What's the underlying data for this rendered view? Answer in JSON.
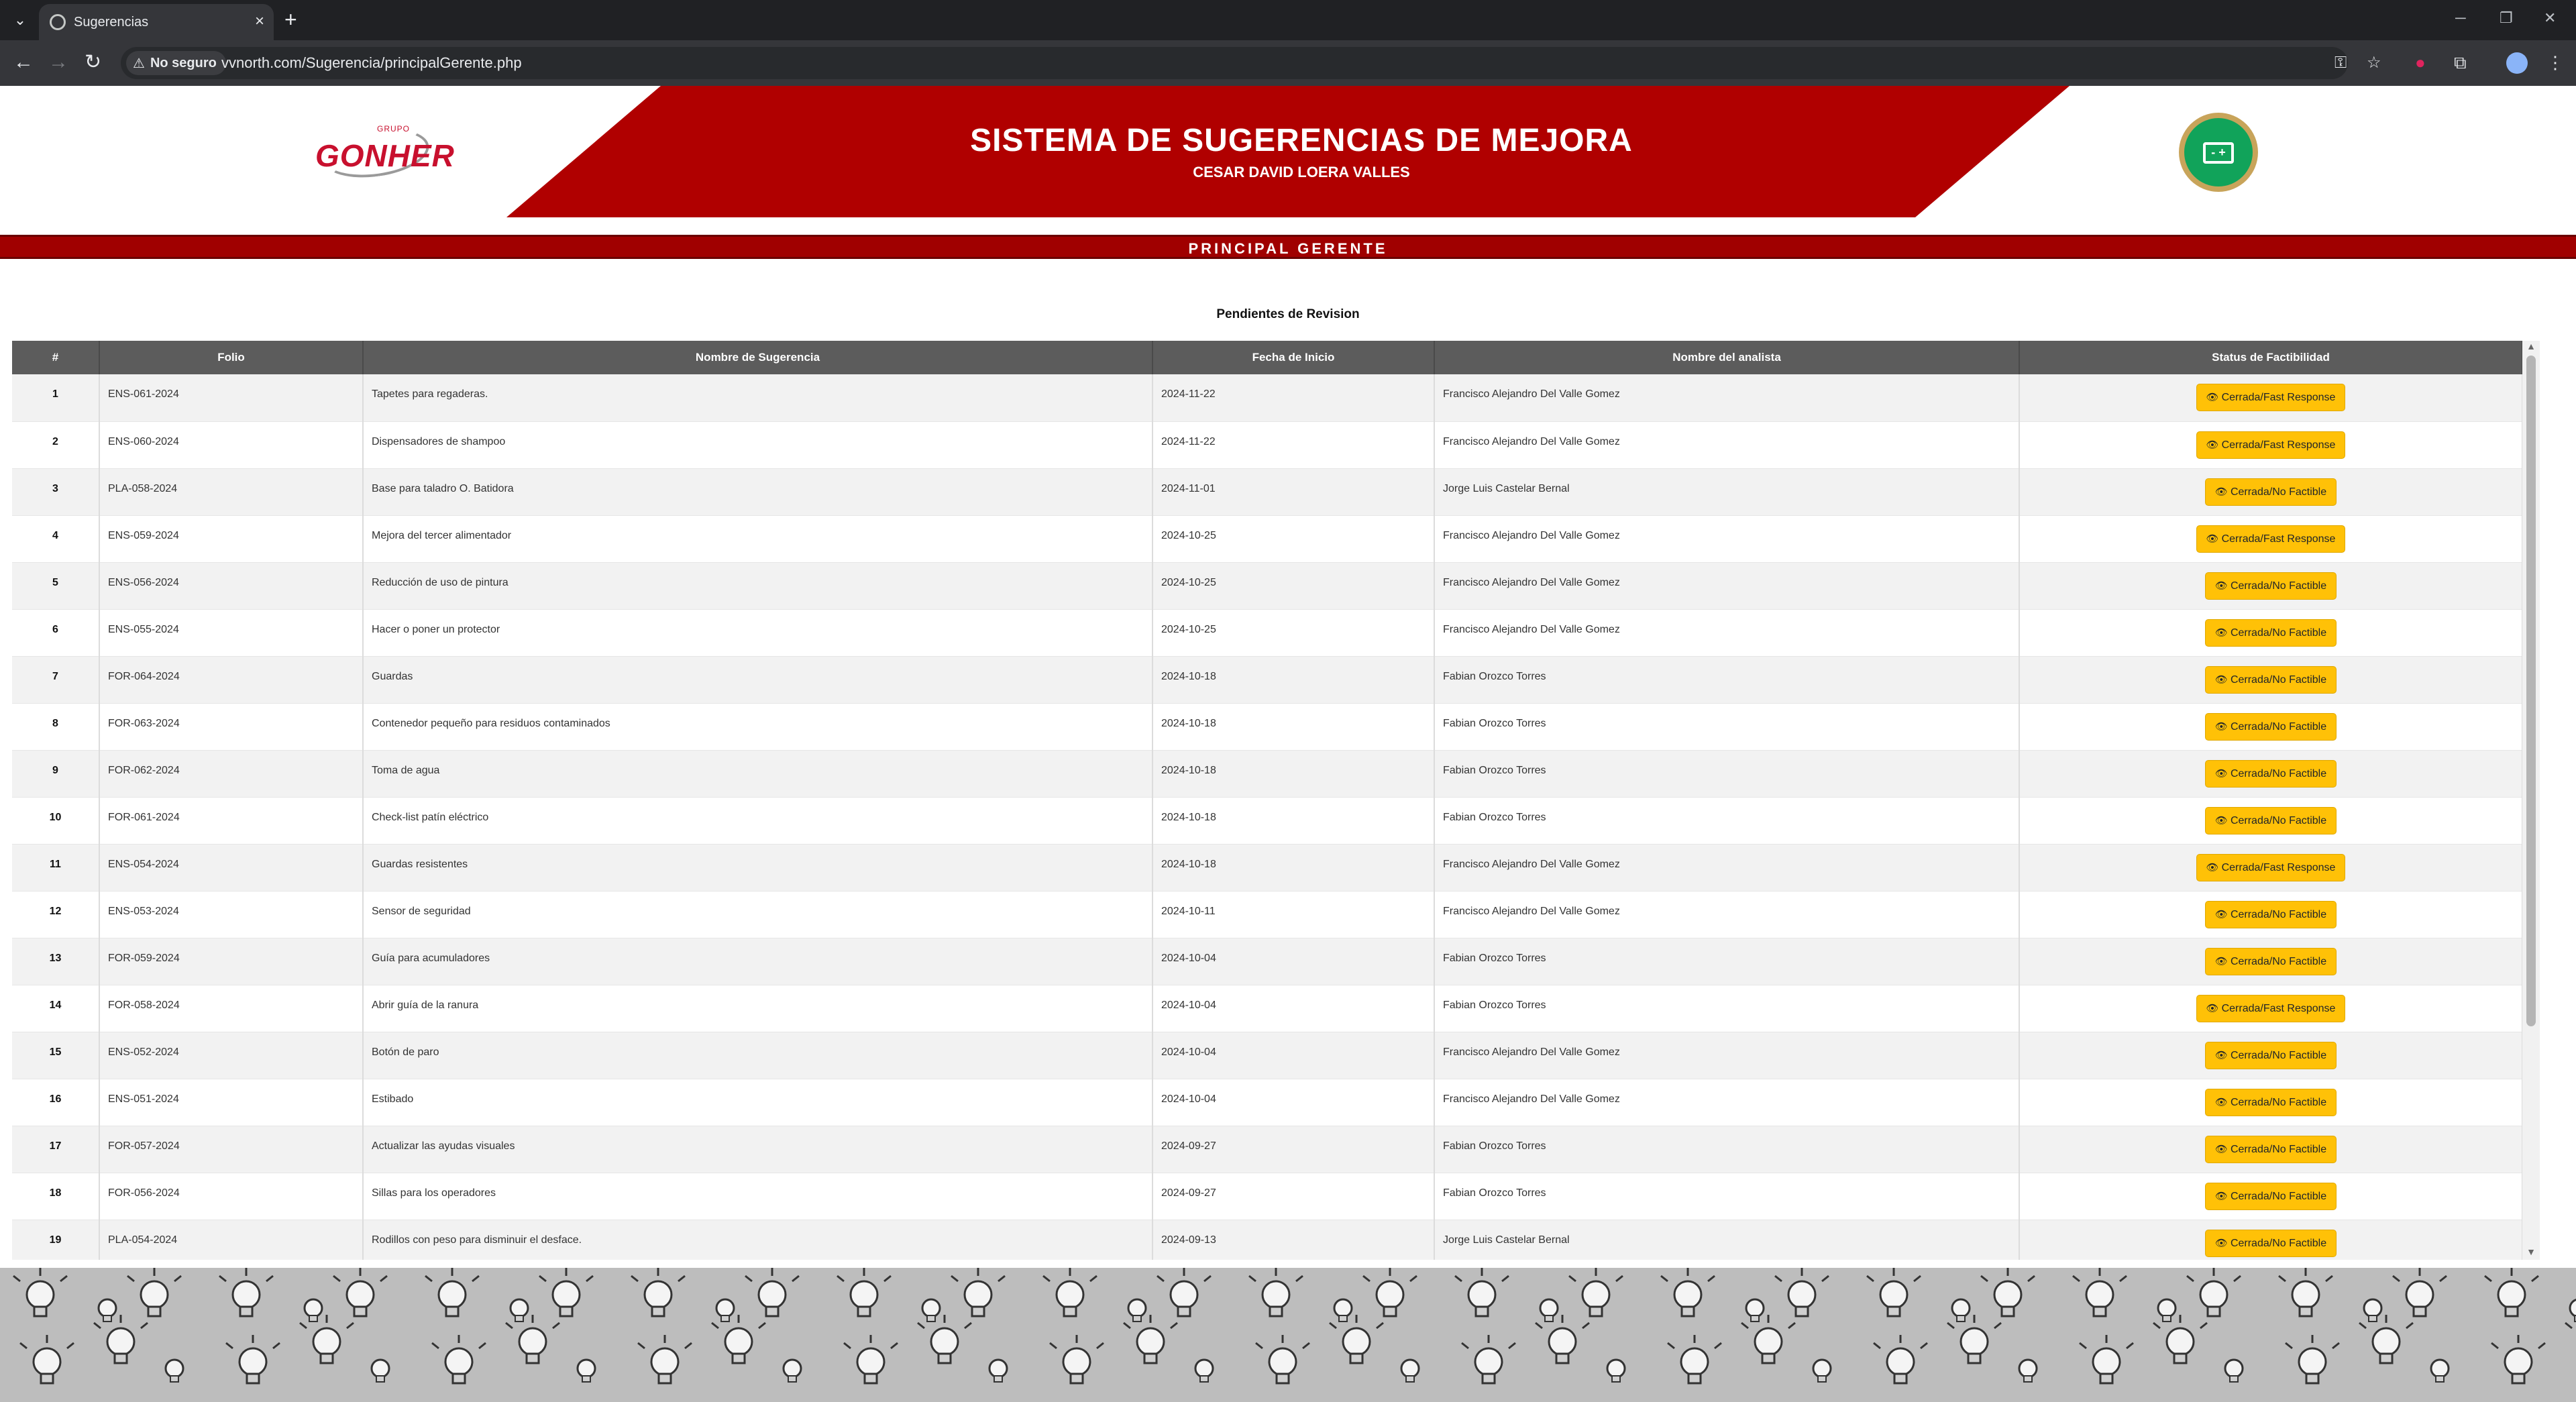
{
  "browser": {
    "tab_title": "Sugerencias",
    "security_label": "No seguro",
    "url": "vvnorth.com/Sugerencia/principalGerente.php"
  },
  "header": {
    "logo_small": "GRUPO",
    "logo_text": "GONHER",
    "title": "SISTEMA DE SUGERENCIAS DE MEJORA",
    "subtitle": "CESAR DAVID LOERA VALLES",
    "page_label": "PRINCIPAL GERENTE",
    "colors": {
      "brand_red": "#b00000",
      "badge_green": "#11a35a",
      "badge_gold": "#c8a45a"
    }
  },
  "section": {
    "title": "Pendientes de Revision"
  },
  "table": {
    "columns": [
      "#",
      "Folio",
      "Nombre de Sugerencia",
      "Fecha de Inicio",
      "Nombre del analista",
      "Status de Factibilidad"
    ],
    "rows": [
      {
        "num": "1",
        "folio": "ENS-061-2024",
        "nombre": "Tapetes para regaderas.",
        "fecha": "2024-11-22",
        "analista": "Francisco Alejandro Del Valle Gomez",
        "status": "Cerrada/Fast Response"
      },
      {
        "num": "2",
        "folio": "ENS-060-2024",
        "nombre": "Dispensadores de shampoo",
        "fecha": "2024-11-22",
        "analista": "Francisco Alejandro Del Valle Gomez",
        "status": "Cerrada/Fast Response"
      },
      {
        "num": "3",
        "folio": "PLA-058-2024",
        "nombre": "Base para taladro O. Batidora",
        "fecha": "2024-11-01",
        "analista": "Jorge Luis Castelar Bernal",
        "status": "Cerrada/No Factible"
      },
      {
        "num": "4",
        "folio": "ENS-059-2024",
        "nombre": "Mejora del tercer alimentador",
        "fecha": "2024-10-25",
        "analista": "Francisco Alejandro Del Valle Gomez",
        "status": "Cerrada/Fast Response"
      },
      {
        "num": "5",
        "folio": "ENS-056-2024",
        "nombre": "Reducción de uso de pintura",
        "fecha": "2024-10-25",
        "analista": "Francisco Alejandro Del Valle Gomez",
        "status": "Cerrada/No Factible"
      },
      {
        "num": "6",
        "folio": "ENS-055-2024",
        "nombre": "Hacer o poner un protector",
        "fecha": "2024-10-25",
        "analista": "Francisco Alejandro Del Valle Gomez",
        "status": "Cerrada/No Factible"
      },
      {
        "num": "7",
        "folio": "FOR-064-2024",
        "nombre": "Guardas",
        "fecha": "2024-10-18",
        "analista": "Fabian Orozco Torres",
        "status": "Cerrada/No Factible"
      },
      {
        "num": "8",
        "folio": "FOR-063-2024",
        "nombre": "Contenedor pequeño para residuos contaminados",
        "fecha": "2024-10-18",
        "analista": "Fabian Orozco Torres",
        "status": "Cerrada/No Factible"
      },
      {
        "num": "9",
        "folio": "FOR-062-2024",
        "nombre": "Toma de agua",
        "fecha": "2024-10-18",
        "analista": "Fabian Orozco Torres",
        "status": "Cerrada/No Factible"
      },
      {
        "num": "10",
        "folio": "FOR-061-2024",
        "nombre": "Check-list patín eléctrico",
        "fecha": "2024-10-18",
        "analista": "Fabian Orozco Torres",
        "status": "Cerrada/No Factible"
      },
      {
        "num": "11",
        "folio": "ENS-054-2024",
        "nombre": "Guardas resistentes",
        "fecha": "2024-10-18",
        "analista": "Francisco Alejandro Del Valle Gomez",
        "status": "Cerrada/Fast Response"
      },
      {
        "num": "12",
        "folio": "ENS-053-2024",
        "nombre": "Sensor de seguridad",
        "fecha": "2024-10-11",
        "analista": "Francisco Alejandro Del Valle Gomez",
        "status": "Cerrada/No Factible"
      },
      {
        "num": "13",
        "folio": "FOR-059-2024",
        "nombre": "Guía para acumuladores",
        "fecha": "2024-10-04",
        "analista": "Fabian Orozco Torres",
        "status": "Cerrada/No Factible"
      },
      {
        "num": "14",
        "folio": "FOR-058-2024",
        "nombre": "Abrir guía de la ranura",
        "fecha": "2024-10-04",
        "analista": "Fabian Orozco Torres",
        "status": "Cerrada/Fast Response"
      },
      {
        "num": "15",
        "folio": "ENS-052-2024",
        "nombre": "Botón de paro",
        "fecha": "2024-10-04",
        "analista": "Francisco Alejandro Del Valle Gomez",
        "status": "Cerrada/No Factible"
      },
      {
        "num": "16",
        "folio": "ENS-051-2024",
        "nombre": "Estibado",
        "fecha": "2024-10-04",
        "analista": "Francisco Alejandro Del Valle Gomez",
        "status": "Cerrada/No Factible"
      },
      {
        "num": "17",
        "folio": "FOR-057-2024",
        "nombre": "Actualizar las ayudas visuales",
        "fecha": "2024-09-27",
        "analista": "Fabian Orozco Torres",
        "status": "Cerrada/No Factible"
      },
      {
        "num": "18",
        "folio": "FOR-056-2024",
        "nombre": "Sillas para los operadores",
        "fecha": "2024-09-27",
        "analista": "Fabian Orozco Torres",
        "status": "Cerrada/No Factible"
      },
      {
        "num": "19",
        "folio": "PLA-054-2024",
        "nombre": "Rodillos con peso para disminuir el desface.",
        "fecha": "2024-09-13",
        "analista": "Jorge Luis Castelar Bernal",
        "status": "Cerrada/No Factible"
      }
    ],
    "status_button_color": "#ffc107"
  }
}
